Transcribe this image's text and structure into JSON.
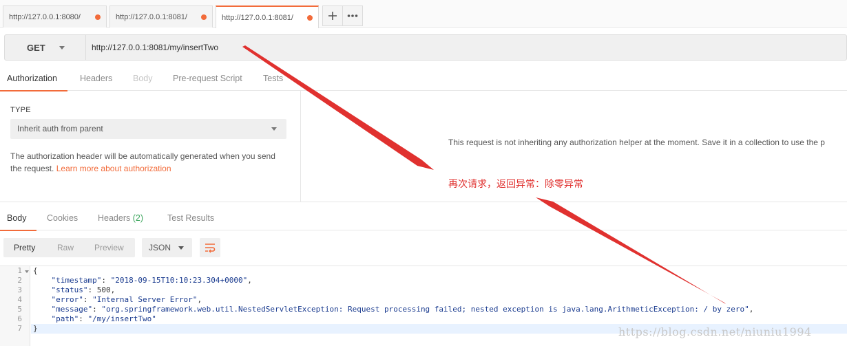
{
  "tabs": [
    {
      "label": "http://127.0.0.1:8080/"
    },
    {
      "label": "http://127.0.0.1:8081/"
    },
    {
      "label": "http://127.0.0.1:8081/"
    }
  ],
  "request": {
    "method": "GET",
    "url": "http://127.0.0.1:8081/my/insertTwo"
  },
  "request_tabs": [
    "Authorization",
    "Headers",
    "Body",
    "Pre-request Script",
    "Tests"
  ],
  "auth": {
    "type_label": "TYPE",
    "type_value": "Inherit auth from parent",
    "description": "The authorization header will be automatically generated when you send the request. ",
    "learn_more": "Learn more about authorization",
    "message": "This request is not inheriting any authorization helper at the moment. Save it in a collection to use the p"
  },
  "annotation": "再次请求，返回异常：除零异常",
  "response_tabs": {
    "body": "Body",
    "cookies": "Cookies",
    "headers": "Headers",
    "headers_count": "(2)",
    "test_results": "Test Results"
  },
  "response_view": {
    "modes": [
      "Pretty",
      "Raw",
      "Preview"
    ],
    "format": "JSON"
  },
  "code": {
    "line_numbers": [
      "1",
      "2",
      "3",
      "4",
      "5",
      "6",
      "7"
    ],
    "lines": {
      "open": "{",
      "timestamp_key": "\"timestamp\"",
      "timestamp_val": "\"2018-09-15T10:10:23.304+0000\"",
      "status_key": "\"status\"",
      "status_val": "500",
      "error_key": "\"error\"",
      "error_val": "\"Internal Server Error\"",
      "message_key": "\"message\"",
      "message_val": "\"org.springframework.web.util.NestedServletException: Request processing failed; nested exception is java.lang.ArithmeticException: / by zero\"",
      "path_key": "\"path\"",
      "path_val": "\"/my/insertTwo\"",
      "close": "}"
    }
  },
  "watermark": "https://blog.csdn.net/niuniu1994",
  "colors": {
    "accent": "#f26b3a",
    "annotation": "#e0312f",
    "count": "#3ba55c"
  },
  "icons": [
    "plus-icon",
    "more-icon",
    "chevron-down-icon",
    "wrap-lines-icon",
    "fold-arrow-icon"
  ]
}
